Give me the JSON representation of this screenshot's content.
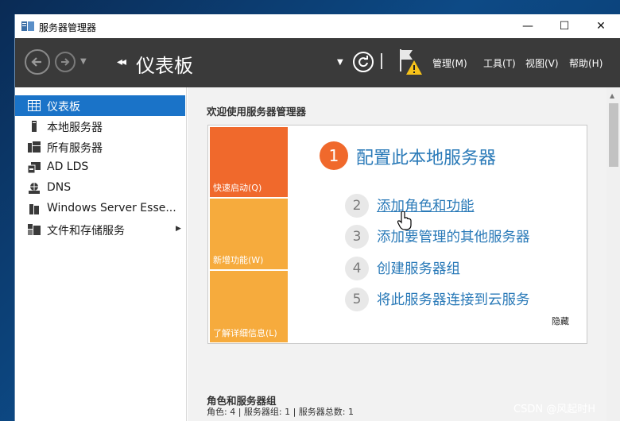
{
  "window": {
    "title": "服务器管理器",
    "controls": {
      "minimize": "—",
      "maximize": "☐",
      "close": "✕"
    }
  },
  "header": {
    "breadcrumb_arrows": "◂◂",
    "page_title": "仪表板",
    "menu": {
      "manage": "管理(M)",
      "tools": "工具(T)",
      "view": "视图(V)",
      "help": "帮助(H)"
    },
    "icons": [
      "back-icon",
      "forward-icon",
      "refresh-icon",
      "notification-flag-icon"
    ]
  },
  "sidebar": {
    "items": [
      {
        "label": "仪表板",
        "icon": "dashboard-icon",
        "active": true
      },
      {
        "label": "本地服务器",
        "icon": "server-icon",
        "active": false
      },
      {
        "label": "所有服务器",
        "icon": "servers-icon",
        "active": false
      },
      {
        "label": "AD LDS",
        "icon": "ad-lds-icon",
        "active": false
      },
      {
        "label": "DNS",
        "icon": "dns-icon",
        "active": false
      },
      {
        "label": "Windows Server Esse...",
        "icon": "windows-server-icon",
        "active": false
      },
      {
        "label": "文件和存储服务",
        "icon": "file-storage-icon",
        "active": false,
        "has_submenu": true
      }
    ]
  },
  "main": {
    "welcome": "欢迎使用服务器管理器",
    "tiles": {
      "quick_start": "快速启动(Q)",
      "whats_new": "新增功能(W)",
      "learn_more": "了解详细信息(L)"
    },
    "steps": [
      {
        "num": "1",
        "label": "配置此本地服务器"
      },
      {
        "num": "2",
        "label": "添加角色和功能"
      },
      {
        "num": "3",
        "label": "添加要管理的其他服务器"
      },
      {
        "num": "4",
        "label": "创建服务器组"
      },
      {
        "num": "5",
        "label": "将此服务器连接到云服务"
      }
    ],
    "hide": "隐藏",
    "roles_title": "角色和服务器组",
    "roles_summary": "角色: 4 | 服务器组: 1 | 服务器总数: 1"
  },
  "colors": {
    "accent_blue": "#1a73c8",
    "header_dark": "#3a3a3a",
    "tile_orange": "#f0692c",
    "tile_amber": "#f6ab3d",
    "link_blue": "#2a7ab8"
  },
  "watermark": "CSDN @风起时H"
}
